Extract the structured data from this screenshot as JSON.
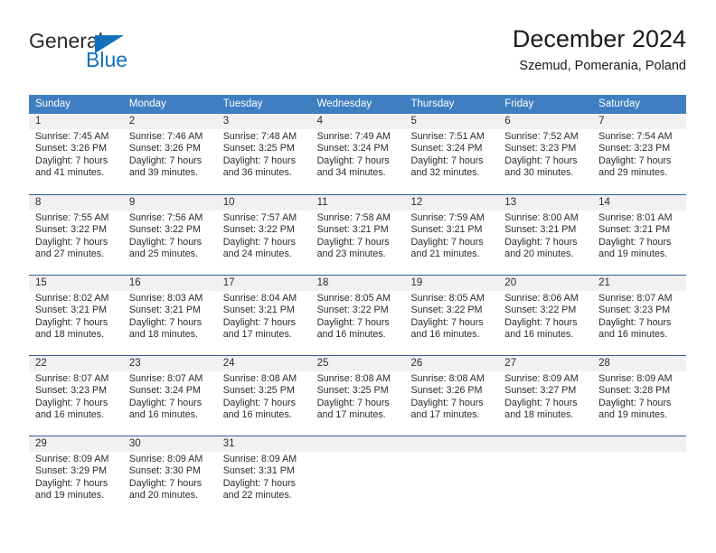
{
  "brand": {
    "name_top": "General",
    "name_bottom": "Blue",
    "triangle_icon": "blue-triangle-logo-mark",
    "color_dark": "#2b2b2b",
    "color_blue": "#1271bd"
  },
  "header": {
    "title": "December 2024",
    "subtitle": "Szemud, Pomerania, Poland"
  },
  "colors": {
    "header_row_bg": "#3f7fc1",
    "week_divider": "#2a6099",
    "daynum_band": "#f1f1f1",
    "text": "#2b2b2b"
  },
  "weekdays": [
    "Sunday",
    "Monday",
    "Tuesday",
    "Wednesday",
    "Thursday",
    "Friday",
    "Saturday"
  ],
  "weeks": [
    {
      "days": [
        {
          "num": "1",
          "sunrise": "Sunrise: 7:45 AM",
          "sunset": "Sunset: 3:26 PM",
          "daylight1": "Daylight: 7 hours",
          "daylight2": "and 41 minutes."
        },
        {
          "num": "2",
          "sunrise": "Sunrise: 7:46 AM",
          "sunset": "Sunset: 3:26 PM",
          "daylight1": "Daylight: 7 hours",
          "daylight2": "and 39 minutes."
        },
        {
          "num": "3",
          "sunrise": "Sunrise: 7:48 AM",
          "sunset": "Sunset: 3:25 PM",
          "daylight1": "Daylight: 7 hours",
          "daylight2": "and 36 minutes."
        },
        {
          "num": "4",
          "sunrise": "Sunrise: 7:49 AM",
          "sunset": "Sunset: 3:24 PM",
          "daylight1": "Daylight: 7 hours",
          "daylight2": "and 34 minutes."
        },
        {
          "num": "5",
          "sunrise": "Sunrise: 7:51 AM",
          "sunset": "Sunset: 3:24 PM",
          "daylight1": "Daylight: 7 hours",
          "daylight2": "and 32 minutes."
        },
        {
          "num": "6",
          "sunrise": "Sunrise: 7:52 AM",
          "sunset": "Sunset: 3:23 PM",
          "daylight1": "Daylight: 7 hours",
          "daylight2": "and 30 minutes."
        },
        {
          "num": "7",
          "sunrise": "Sunrise: 7:54 AM",
          "sunset": "Sunset: 3:23 PM",
          "daylight1": "Daylight: 7 hours",
          "daylight2": "and 29 minutes."
        }
      ]
    },
    {
      "days": [
        {
          "num": "8",
          "sunrise": "Sunrise: 7:55 AM",
          "sunset": "Sunset: 3:22 PM",
          "daylight1": "Daylight: 7 hours",
          "daylight2": "and 27 minutes."
        },
        {
          "num": "9",
          "sunrise": "Sunrise: 7:56 AM",
          "sunset": "Sunset: 3:22 PM",
          "daylight1": "Daylight: 7 hours",
          "daylight2": "and 25 minutes."
        },
        {
          "num": "10",
          "sunrise": "Sunrise: 7:57 AM",
          "sunset": "Sunset: 3:22 PM",
          "daylight1": "Daylight: 7 hours",
          "daylight2": "and 24 minutes."
        },
        {
          "num": "11",
          "sunrise": "Sunrise: 7:58 AM",
          "sunset": "Sunset: 3:21 PM",
          "daylight1": "Daylight: 7 hours",
          "daylight2": "and 23 minutes."
        },
        {
          "num": "12",
          "sunrise": "Sunrise: 7:59 AM",
          "sunset": "Sunset: 3:21 PM",
          "daylight1": "Daylight: 7 hours",
          "daylight2": "and 21 minutes."
        },
        {
          "num": "13",
          "sunrise": "Sunrise: 8:00 AM",
          "sunset": "Sunset: 3:21 PM",
          "daylight1": "Daylight: 7 hours",
          "daylight2": "and 20 minutes."
        },
        {
          "num": "14",
          "sunrise": "Sunrise: 8:01 AM",
          "sunset": "Sunset: 3:21 PM",
          "daylight1": "Daylight: 7 hours",
          "daylight2": "and 19 minutes."
        }
      ]
    },
    {
      "days": [
        {
          "num": "15",
          "sunrise": "Sunrise: 8:02 AM",
          "sunset": "Sunset: 3:21 PM",
          "daylight1": "Daylight: 7 hours",
          "daylight2": "and 18 minutes."
        },
        {
          "num": "16",
          "sunrise": "Sunrise: 8:03 AM",
          "sunset": "Sunset: 3:21 PM",
          "daylight1": "Daylight: 7 hours",
          "daylight2": "and 18 minutes."
        },
        {
          "num": "17",
          "sunrise": "Sunrise: 8:04 AM",
          "sunset": "Sunset: 3:21 PM",
          "daylight1": "Daylight: 7 hours",
          "daylight2": "and 17 minutes."
        },
        {
          "num": "18",
          "sunrise": "Sunrise: 8:05 AM",
          "sunset": "Sunset: 3:22 PM",
          "daylight1": "Daylight: 7 hours",
          "daylight2": "and 16 minutes."
        },
        {
          "num": "19",
          "sunrise": "Sunrise: 8:05 AM",
          "sunset": "Sunset: 3:22 PM",
          "daylight1": "Daylight: 7 hours",
          "daylight2": "and 16 minutes."
        },
        {
          "num": "20",
          "sunrise": "Sunrise: 8:06 AM",
          "sunset": "Sunset: 3:22 PM",
          "daylight1": "Daylight: 7 hours",
          "daylight2": "and 16 minutes."
        },
        {
          "num": "21",
          "sunrise": "Sunrise: 8:07 AM",
          "sunset": "Sunset: 3:23 PM",
          "daylight1": "Daylight: 7 hours",
          "daylight2": "and 16 minutes."
        }
      ]
    },
    {
      "days": [
        {
          "num": "22",
          "sunrise": "Sunrise: 8:07 AM",
          "sunset": "Sunset: 3:23 PM",
          "daylight1": "Daylight: 7 hours",
          "daylight2": "and 16 minutes."
        },
        {
          "num": "23",
          "sunrise": "Sunrise: 8:07 AM",
          "sunset": "Sunset: 3:24 PM",
          "daylight1": "Daylight: 7 hours",
          "daylight2": "and 16 minutes."
        },
        {
          "num": "24",
          "sunrise": "Sunrise: 8:08 AM",
          "sunset": "Sunset: 3:25 PM",
          "daylight1": "Daylight: 7 hours",
          "daylight2": "and 16 minutes."
        },
        {
          "num": "25",
          "sunrise": "Sunrise: 8:08 AM",
          "sunset": "Sunset: 3:25 PM",
          "daylight1": "Daylight: 7 hours",
          "daylight2": "and 17 minutes."
        },
        {
          "num": "26",
          "sunrise": "Sunrise: 8:08 AM",
          "sunset": "Sunset: 3:26 PM",
          "daylight1": "Daylight: 7 hours",
          "daylight2": "and 17 minutes."
        },
        {
          "num": "27",
          "sunrise": "Sunrise: 8:09 AM",
          "sunset": "Sunset: 3:27 PM",
          "daylight1": "Daylight: 7 hours",
          "daylight2": "and 18 minutes."
        },
        {
          "num": "28",
          "sunrise": "Sunrise: 8:09 AM",
          "sunset": "Sunset: 3:28 PM",
          "daylight1": "Daylight: 7 hours",
          "daylight2": "and 19 minutes."
        }
      ]
    },
    {
      "days": [
        {
          "num": "29",
          "sunrise": "Sunrise: 8:09 AM",
          "sunset": "Sunset: 3:29 PM",
          "daylight1": "Daylight: 7 hours",
          "daylight2": "and 19 minutes."
        },
        {
          "num": "30",
          "sunrise": "Sunrise: 8:09 AM",
          "sunset": "Sunset: 3:30 PM",
          "daylight1": "Daylight: 7 hours",
          "daylight2": "and 20 minutes."
        },
        {
          "num": "31",
          "sunrise": "Sunrise: 8:09 AM",
          "sunset": "Sunset: 3:31 PM",
          "daylight1": "Daylight: 7 hours",
          "daylight2": "and 22 minutes."
        },
        {
          "num": "",
          "sunrise": "",
          "sunset": "",
          "daylight1": "",
          "daylight2": ""
        },
        {
          "num": "",
          "sunrise": "",
          "sunset": "",
          "daylight1": "",
          "daylight2": ""
        },
        {
          "num": "",
          "sunrise": "",
          "sunset": "",
          "daylight1": "",
          "daylight2": ""
        },
        {
          "num": "",
          "sunrise": "",
          "sunset": "",
          "daylight1": "",
          "daylight2": ""
        }
      ]
    }
  ]
}
